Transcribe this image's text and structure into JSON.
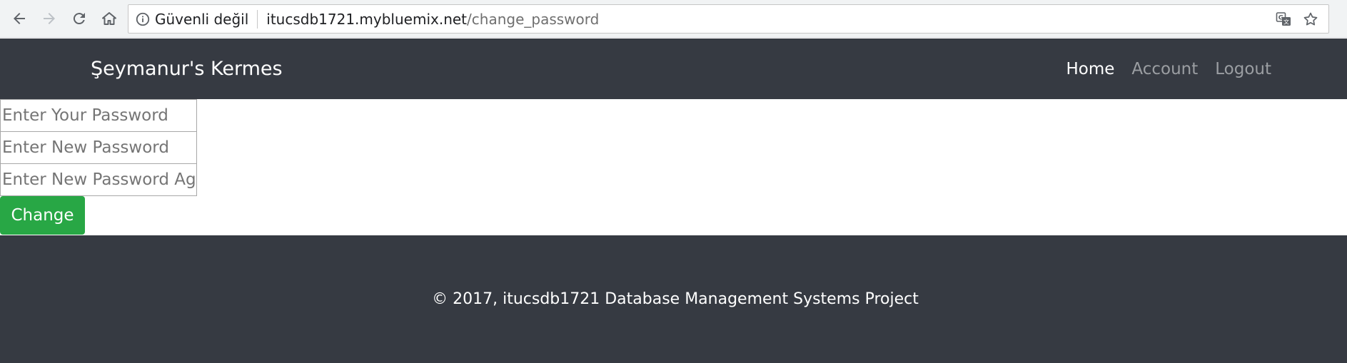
{
  "browser": {
    "security_label": "Güvenli değil",
    "url_host": "itucsdb1721.mybluemix.net",
    "url_path": "/change_password",
    "icons": [
      "back-icon",
      "forward-icon",
      "reload-icon",
      "home-icon",
      "info-icon",
      "translate-icon",
      "star-icon"
    ]
  },
  "navbar": {
    "brand": "Şeymanur's Kermes",
    "links": [
      {
        "label": "Home",
        "active": true
      },
      {
        "label": "Account",
        "active": false
      },
      {
        "label": "Logout",
        "active": false
      }
    ]
  },
  "form": {
    "current_password_placeholder": "Enter Your Password",
    "new_password_placeholder": "Enter New Password",
    "confirm_password_placeholder": "Enter New Password Again",
    "submit_label": "Change"
  },
  "footer": {
    "text": "© 2017, itucsdb1721 Database Management Systems Project"
  },
  "colors": {
    "navbar_bg": "#363a42",
    "button_green": "#28a745",
    "nav_active": "#ffffff",
    "nav_inactive": "#9b9ea2"
  }
}
